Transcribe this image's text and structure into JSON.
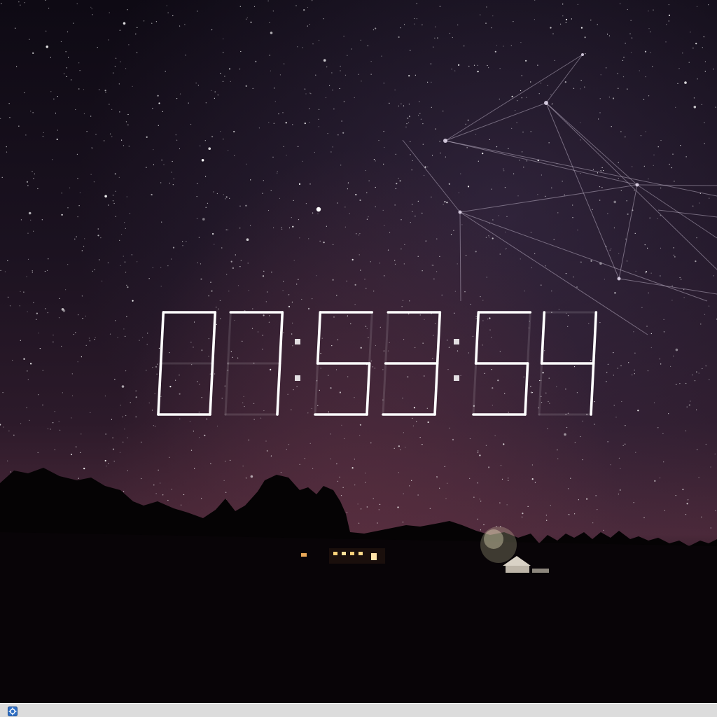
{
  "screen": {
    "type": "desktop-screensaver",
    "wallpaper": "night-sky-starfield",
    "colors": {
      "sky_top": "#0e0a14",
      "sky_horizon": "#4a2838",
      "ground": "#030203",
      "segment": "#ffffff",
      "taskbar": "#dcdcdc"
    }
  },
  "clock": {
    "time": "07:53:54",
    "digits": [
      "0",
      "7",
      "5",
      "3",
      "5",
      "4"
    ],
    "separator": ":"
  },
  "taskbar": {
    "icon": "settings-gear-icon"
  }
}
